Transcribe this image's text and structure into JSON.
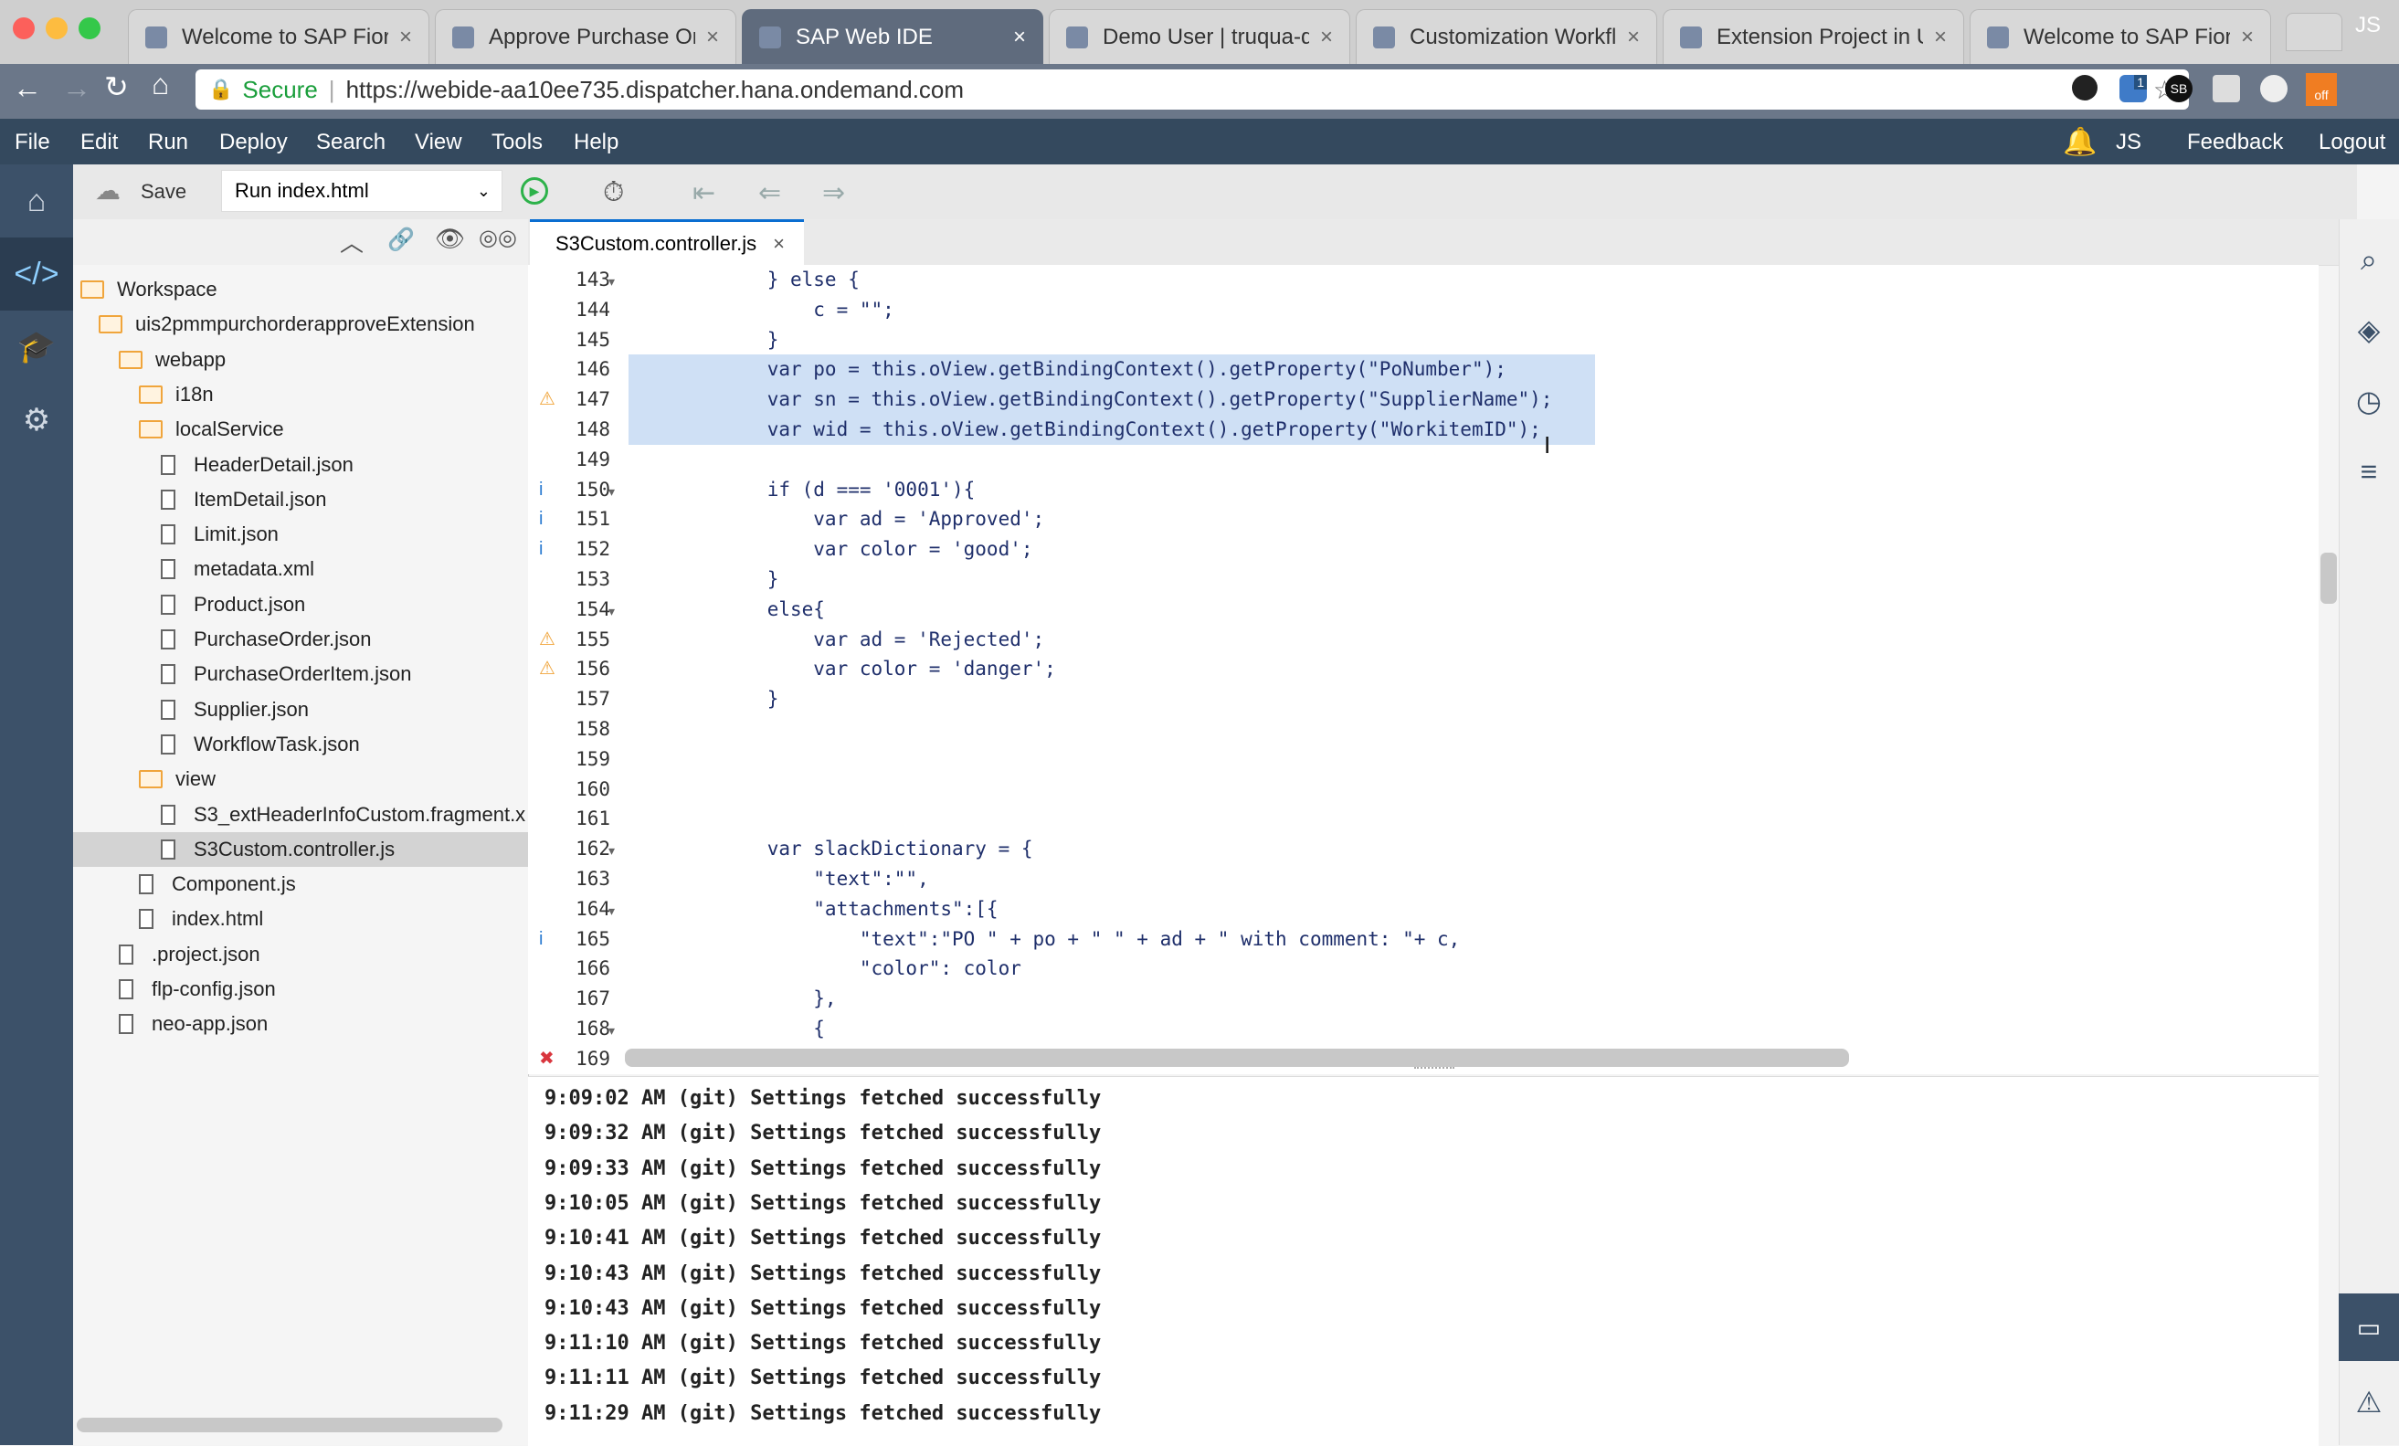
{
  "browser": {
    "tabs": [
      {
        "title": "Welcome to SAP Fiori C",
        "active": false
      },
      {
        "title": "Approve Purchase Ord",
        "active": false
      },
      {
        "title": "SAP Web IDE",
        "active": true
      },
      {
        "title": "Demo User | truqua-de",
        "active": false
      },
      {
        "title": "Customization Workflo",
        "active": false
      },
      {
        "title": "Extension Project in U",
        "active": false
      },
      {
        "title": "Welcome to SAP Fiori C",
        "active": false
      }
    ],
    "profile_initials": "JS",
    "secure_label": "Secure",
    "url": "https://webide-aa10ee735.dispatcher.hana.ondemand.com",
    "ext_badge": "1",
    "ext_sb": "SB",
    "ext_off": "off"
  },
  "menubar": {
    "items": [
      "File",
      "Edit",
      "Run",
      "Deploy",
      "Search",
      "View",
      "Tools",
      "Help"
    ],
    "user_initials": "JS",
    "feedback": "Feedback",
    "logout": "Logout"
  },
  "toolbar": {
    "save_label": "Save",
    "run_config": "Run index.html"
  },
  "explorer": {
    "rows": [
      {
        "label": "Workspace",
        "type": "folder",
        "depth": 0
      },
      {
        "label": "uis2pmmpurchorderapproveExtension",
        "type": "folder",
        "depth": 1
      },
      {
        "label": "webapp",
        "type": "folder",
        "depth": 2
      },
      {
        "label": "i18n",
        "type": "folder",
        "depth": 3
      },
      {
        "label": "localService",
        "type": "folder",
        "depth": 3
      },
      {
        "label": "HeaderDetail.json",
        "type": "file",
        "depth": 4
      },
      {
        "label": "ItemDetail.json",
        "type": "file",
        "depth": 4
      },
      {
        "label": "Limit.json",
        "type": "file",
        "depth": 4
      },
      {
        "label": "metadata.xml",
        "type": "file",
        "depth": 4
      },
      {
        "label": "Product.json",
        "type": "file",
        "depth": 4
      },
      {
        "label": "PurchaseOrder.json",
        "type": "file",
        "depth": 4
      },
      {
        "label": "PurchaseOrderItem.json",
        "type": "file",
        "depth": 4
      },
      {
        "label": "Supplier.json",
        "type": "file",
        "depth": 4
      },
      {
        "label": "WorkflowTask.json",
        "type": "file",
        "depth": 4
      },
      {
        "label": "view",
        "type": "folder",
        "depth": 3
      },
      {
        "label": "S3_extHeaderInfoCustom.fragment.x",
        "type": "file",
        "depth": 4
      },
      {
        "label": "S3Custom.controller.js",
        "type": "file",
        "depth": 4,
        "selected": true
      },
      {
        "label": "Component.js",
        "type": "file",
        "depth": 3
      },
      {
        "label": "index.html",
        "type": "file",
        "depth": 3
      },
      {
        "label": ".project.json",
        "type": "file",
        "depth": 2
      },
      {
        "label": "flp-config.json",
        "type": "file",
        "depth": 2
      },
      {
        "label": "neo-app.json",
        "type": "file",
        "depth": 2
      }
    ]
  },
  "editor": {
    "tab_label": "S3Custom.controller.js",
    "lines": [
      {
        "num": "143",
        "text": "            } else {",
        "fold": true,
        "marker": ""
      },
      {
        "num": "144",
        "text": "                c = \"\";",
        "marker": ""
      },
      {
        "num": "145",
        "text": "            }",
        "marker": ""
      },
      {
        "num": "146",
        "text": "            var po = this.oView.getBindingContext().getProperty(\"PoNumber\");",
        "hl": true,
        "marker": ""
      },
      {
        "num": "147",
        "text": "            var sn = this.oView.getBindingContext().getProperty(\"SupplierName\");",
        "hl": true,
        "marker": "warn"
      },
      {
        "num": "148",
        "text": "            var wid = this.oView.getBindingContext().getProperty(\"WorkitemID\");",
        "hl": true,
        "marker": ""
      },
      {
        "num": "149",
        "text": "",
        "marker": ""
      },
      {
        "num": "150",
        "text": "            if (d === '0001'){",
        "fold": true,
        "marker": "info"
      },
      {
        "num": "151",
        "text": "                var ad = 'Approved';",
        "marker": "info"
      },
      {
        "num": "152",
        "text": "                var color = 'good';",
        "marker": "info"
      },
      {
        "num": "153",
        "text": "            }",
        "marker": ""
      },
      {
        "num": "154",
        "text": "            else{",
        "fold": true,
        "marker": ""
      },
      {
        "num": "155",
        "text": "                var ad = 'Rejected';",
        "marker": "warn"
      },
      {
        "num": "156",
        "text": "                var color = 'danger';",
        "marker": "warn"
      },
      {
        "num": "157",
        "text": "            }",
        "marker": ""
      },
      {
        "num": "158",
        "text": "",
        "marker": ""
      },
      {
        "num": "159",
        "text": "",
        "marker": ""
      },
      {
        "num": "160",
        "text": "",
        "marker": ""
      },
      {
        "num": "161",
        "text": "",
        "marker": ""
      },
      {
        "num": "162",
        "text": "            var slackDictionary = {",
        "fold": true,
        "marker": ""
      },
      {
        "num": "163",
        "text": "                \"text\":\"\",",
        "marker": ""
      },
      {
        "num": "164",
        "text": "                \"attachments\":[{",
        "fold": true,
        "marker": ""
      },
      {
        "num": "165",
        "text": "                    \"text\":\"PO \" + po + \" \" + ad + \" with comment: \"+ c,",
        "marker": "info"
      },
      {
        "num": "166",
        "text": "                    \"color\": color",
        "marker": ""
      },
      {
        "num": "167",
        "text": "                },",
        "marker": ""
      },
      {
        "num": "168",
        "text": "                {",
        "fold": true,
        "marker": ""
      },
      {
        "num": "169",
        "text": "",
        "marker": "error"
      }
    ]
  },
  "console": {
    "lines": [
      "9:09:02 AM (git) Settings fetched successfully",
      "9:09:32 AM (git) Settings fetched successfully",
      "9:09:33 AM (git) Settings fetched successfully",
      "9:10:05 AM (git) Settings fetched successfully",
      "9:10:41 AM (git) Settings fetched successfully",
      "9:10:43 AM (git) Settings fetched successfully",
      "9:10:43 AM (git) Settings fetched successfully",
      "9:11:10 AM (git) Settings fetched successfully",
      "9:11:11 AM (git) Settings fetched successfully",
      "9:11:29 AM (git) Settings fetched successfully"
    ]
  },
  "colors": {
    "menubar": "#34495e",
    "leftnav": "#3c5169",
    "selection": "#cfe0f5",
    "accent": "#0a6ed1",
    "warning": "#f0a53c",
    "info": "#2a7bd0",
    "error": "#d9363e"
  }
}
